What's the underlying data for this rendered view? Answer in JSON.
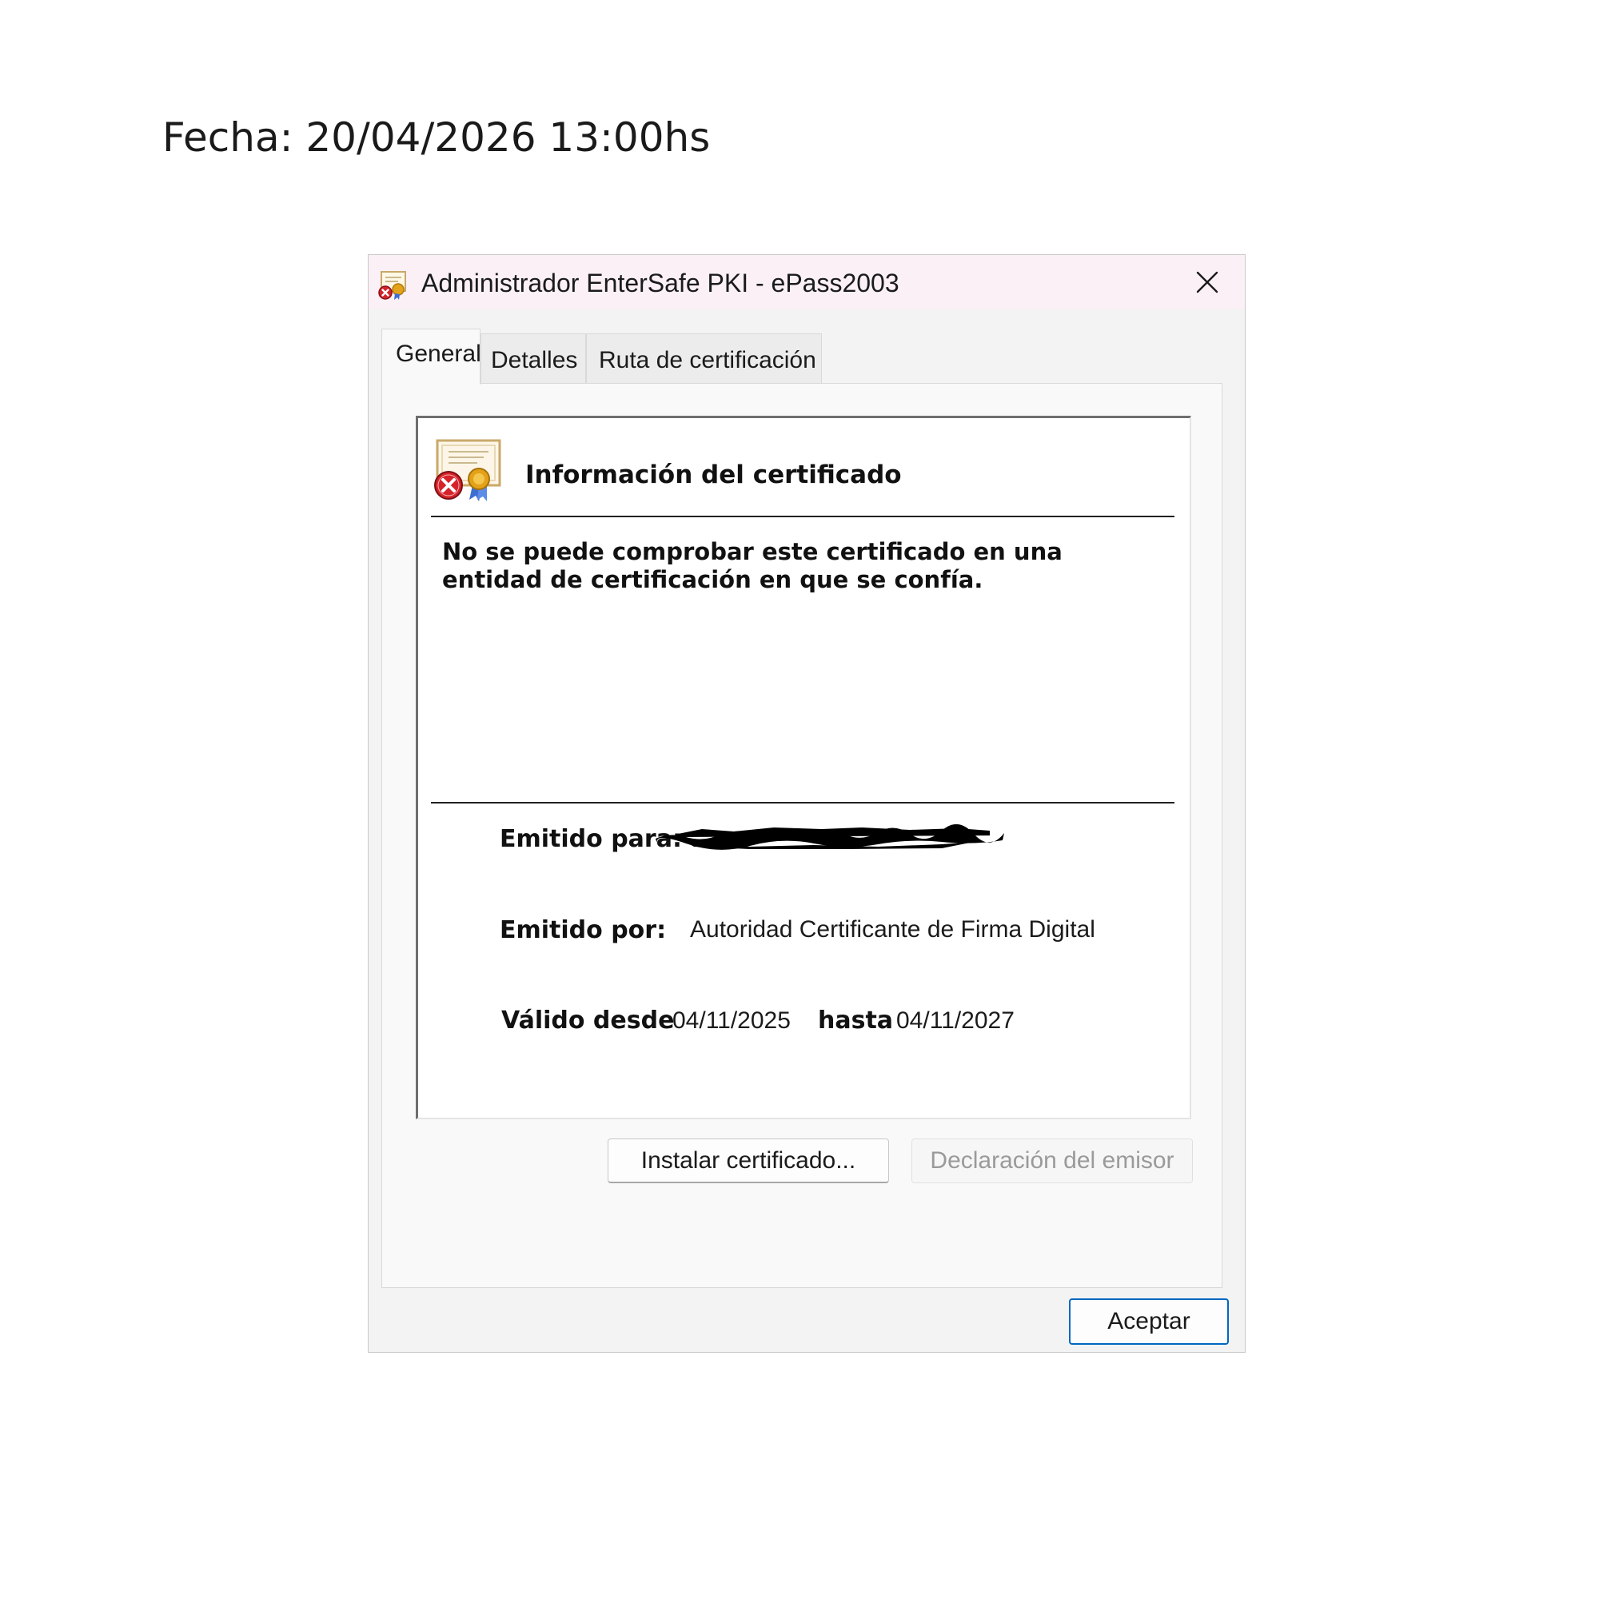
{
  "page": {
    "date_text": "Fecha: 20/04/2026 13:00hs"
  },
  "window": {
    "title": "Administrador EnterSafe PKI  - ePass2003",
    "app_icon": "certificate-error-icon",
    "close_icon": "close-icon"
  },
  "tabs": [
    {
      "label": "General",
      "selected": true
    },
    {
      "label": "Detalles",
      "selected": false
    },
    {
      "label": "Ruta de certificación",
      "selected": false
    }
  ],
  "certificate": {
    "icon": "certificate-error-icon",
    "heading": "Información del certificado",
    "warning_line1": "No se puede comprobar este certificado en una",
    "warning_line2": "entidad de certificación en que se confía.",
    "issued_to_label": "Emitido para:",
    "issued_to_value_redacted": true,
    "issued_by_label": "Emitido por:",
    "issued_by_value": "Autoridad Certificante de Firma Digital",
    "valid_from_label": "Válido desde",
    "valid_from_value": "04/11/2025",
    "valid_to_label": "hasta",
    "valid_to_value": "04/11/2027"
  },
  "buttons": {
    "install": "Instalar certificado...",
    "issuer_statement": "Declaración del emisor",
    "issuer_statement_enabled": false,
    "ok": "Aceptar"
  },
  "colors": {
    "accent": "#0067c0",
    "titlebar": "#faf0f6",
    "error": "#d6232a",
    "seal": "#e3a21a"
  }
}
